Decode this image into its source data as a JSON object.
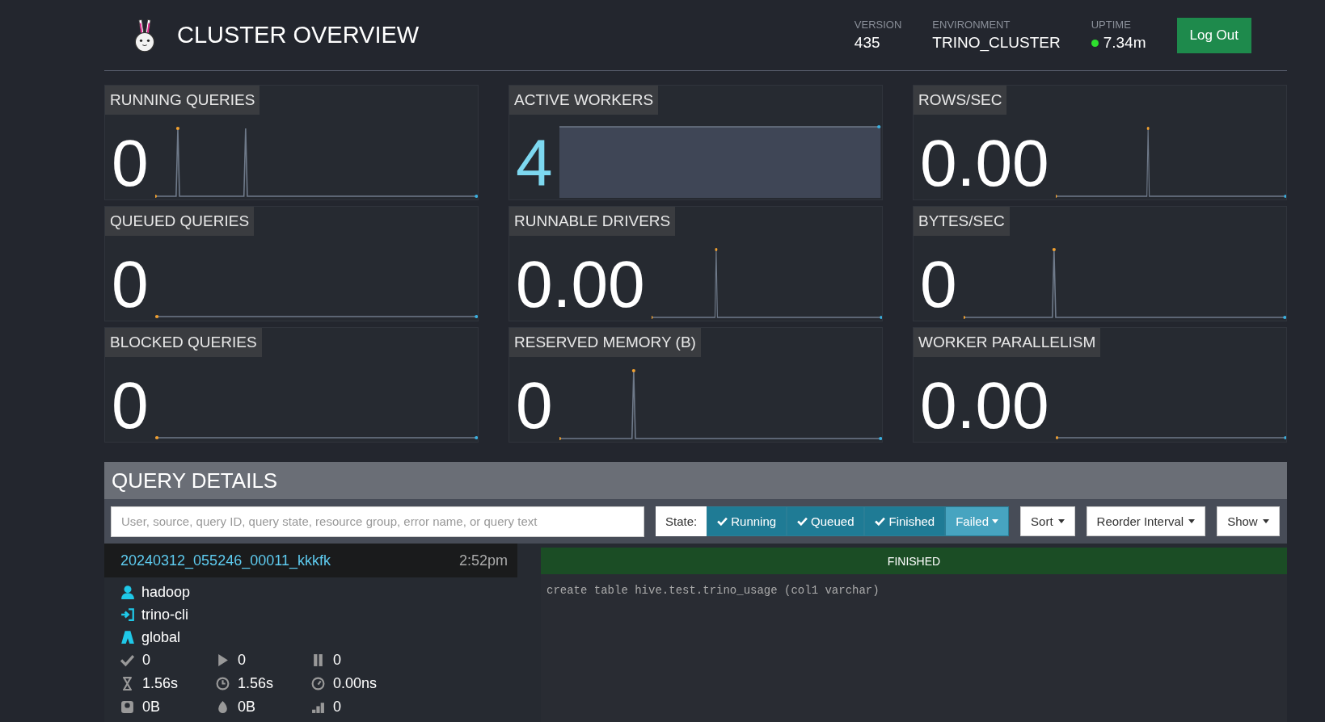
{
  "header": {
    "title": "CLUSTER OVERVIEW",
    "info": [
      {
        "label": "VERSION",
        "value": "435",
        "status_dot": false
      },
      {
        "label": "ENVIRONMENT",
        "value": "TRINO_CLUSTER",
        "status_dot": false
      },
      {
        "label": "UPTIME",
        "value": "7.34m",
        "status_dot": true
      }
    ],
    "logout_button": "Log Out"
  },
  "tiles": [
    {
      "title": "RUNNING QUERIES",
      "value": "0",
      "kind": "sparkline",
      "accent": false
    },
    {
      "title": "ACTIVE WORKERS",
      "value": "4",
      "kind": "block",
      "accent": true
    },
    {
      "title": "ROWS/SEC",
      "value": "0.00",
      "kind": "sparkline",
      "accent": false
    },
    {
      "title": "QUEUED QUERIES",
      "value": "0",
      "kind": "sparkline",
      "accent": false
    },
    {
      "title": "RUNNABLE DRIVERS",
      "value": "0.00",
      "kind": "sparkline",
      "accent": false
    },
    {
      "title": "BYTES/SEC",
      "value": "0",
      "kind": "sparkline",
      "accent": false
    },
    {
      "title": "BLOCKED QUERIES",
      "value": "0",
      "kind": "sparkline",
      "accent": false
    },
    {
      "title": "RESERVED MEMORY (B)",
      "value": "0",
      "kind": "sparkline",
      "accent": false
    },
    {
      "title": "WORKER PARALLELISM",
      "value": "0.00",
      "kind": "sparkline",
      "accent": false
    }
  ],
  "query_details": {
    "title": "QUERY DETAILS",
    "search": {
      "placeholder": "User, source, query ID, query state, resource group, error name, or query text"
    },
    "state_label": "State:",
    "state_filters": [
      {
        "label": "Running",
        "selected": true,
        "dropdown": false
      },
      {
        "label": "Queued",
        "selected": true,
        "dropdown": false
      },
      {
        "label": "Finished",
        "selected": true,
        "dropdown": false
      },
      {
        "label": "Failed",
        "selected": false,
        "dropdown": true
      }
    ],
    "menus": [
      "Sort",
      "Reorder Interval",
      "Show"
    ],
    "queries": [
      {
        "id": "20240312_055246_00011_kkkfk",
        "time": "2:52pm",
        "state": "FINISHED",
        "user": "hadoop",
        "source": "trino-cli",
        "resource_group": "global",
        "stats": [
          {
            "kind": "completed",
            "value": "0"
          },
          {
            "kind": "running",
            "value": "0"
          },
          {
            "kind": "blocked",
            "value": "0"
          },
          {
            "kind": "wall",
            "value": "1.56s"
          },
          {
            "kind": "elapsed",
            "value": "1.56s"
          },
          {
            "kind": "cpu",
            "value": "0.00ns"
          },
          {
            "kind": "memory",
            "value": "0B"
          },
          {
            "kind": "peak",
            "value": "0B"
          },
          {
            "kind": "drivers",
            "value": "0"
          }
        ],
        "sql": "create table hive.test.trino_usage (col1 varchar)"
      }
    ]
  }
}
